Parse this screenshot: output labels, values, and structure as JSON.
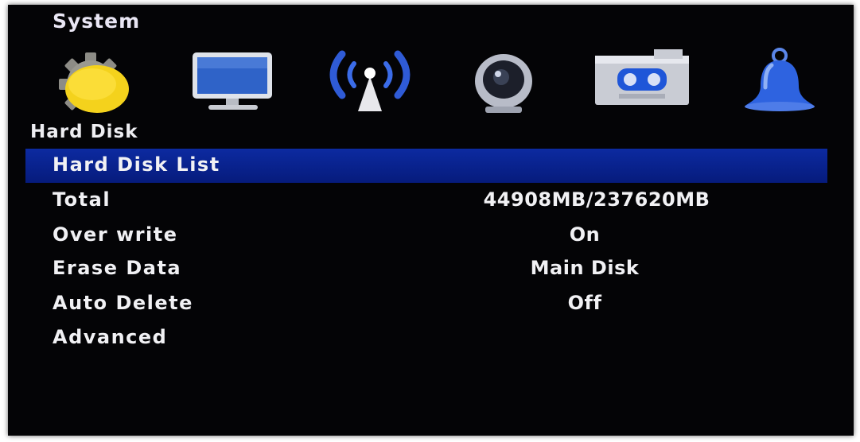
{
  "header": {
    "title": "System"
  },
  "icons": [
    {
      "name": "gear-icon"
    },
    {
      "name": "monitor-icon"
    },
    {
      "name": "network-icon"
    },
    {
      "name": "camera-icon"
    },
    {
      "name": "record-icon"
    },
    {
      "name": "bell-icon"
    }
  ],
  "section": {
    "title": "Hard Disk"
  },
  "menu": {
    "selected": "Hard Disk List",
    "items": [
      {
        "label": "Hard Disk List",
        "value": ""
      },
      {
        "label": "Total",
        "value": "44908MB/237620MB"
      },
      {
        "label": "Over write",
        "value": "On"
      },
      {
        "label": "Erase Data",
        "value": "Main Disk"
      },
      {
        "label": "Auto Delete",
        "value": "Off"
      },
      {
        "label": "Advanced",
        "value": ""
      }
    ]
  },
  "colors": {
    "background": "#040406",
    "highlight": "#0a239a",
    "text": "#f1f1f4"
  }
}
